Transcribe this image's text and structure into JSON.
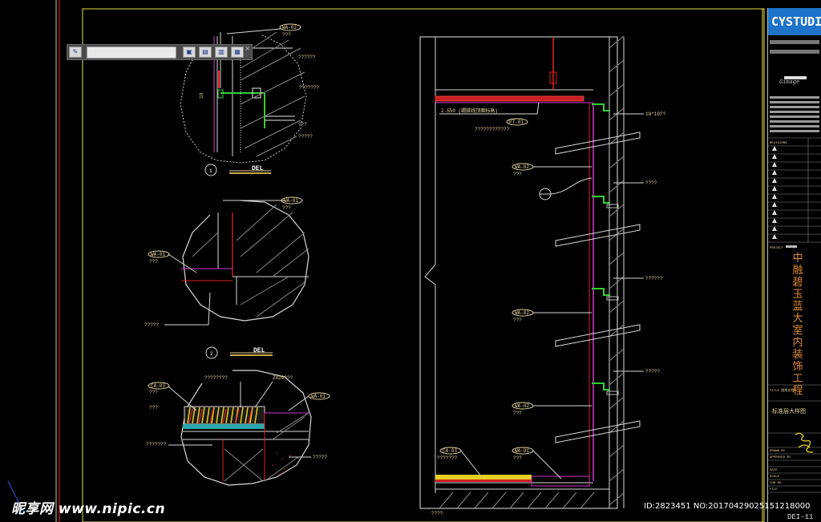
{
  "toolbar": {
    "input_value": "",
    "buttons": [
      "edit-icon",
      "layer-a-icon",
      "layer-b-icon",
      "layer-c-icon",
      "layer-d-icon"
    ],
    "close_label": "×"
  },
  "title_block": {
    "brand": "CYSTUDIO",
    "logo_text": "Gimage",
    "revisions_label": "REVISIONS",
    "project_label": "PROJECT",
    "project_name": "中融碧玉蓝大室内装饰工程",
    "title_label": "TITLE 图纸名称",
    "sheet_title": "标准层大样图",
    "drawn_by": "DRAWN BY",
    "approved_by": "APPROVED BY",
    "date_label": "DATE",
    "scale_label": "SCALE",
    "job_no_label": "JOB NO",
    "file_label": "FILE",
    "sheet_no": "DEI-11"
  },
  "drawing": {
    "detail1_tag": "1",
    "detail2_tag": "2",
    "del_label": "DEL",
    "tags": [
      "WA-02",
      "WA-01",
      "CA-03",
      "WA-01",
      "WA-02",
      "WA-02",
      "WA-02",
      "CA-03",
      "WA-01",
      "PT-01"
    ],
    "section_note": "2.550 (踢脚线顶面标高)",
    "dim_note_1": "ZX29???",
    "dim_note_2": "10*10??"
  },
  "watermark": {
    "text": "昵享网 www.nipic.cn",
    "id_line": "ID:2823451 NO:20170429025151218000"
  }
}
